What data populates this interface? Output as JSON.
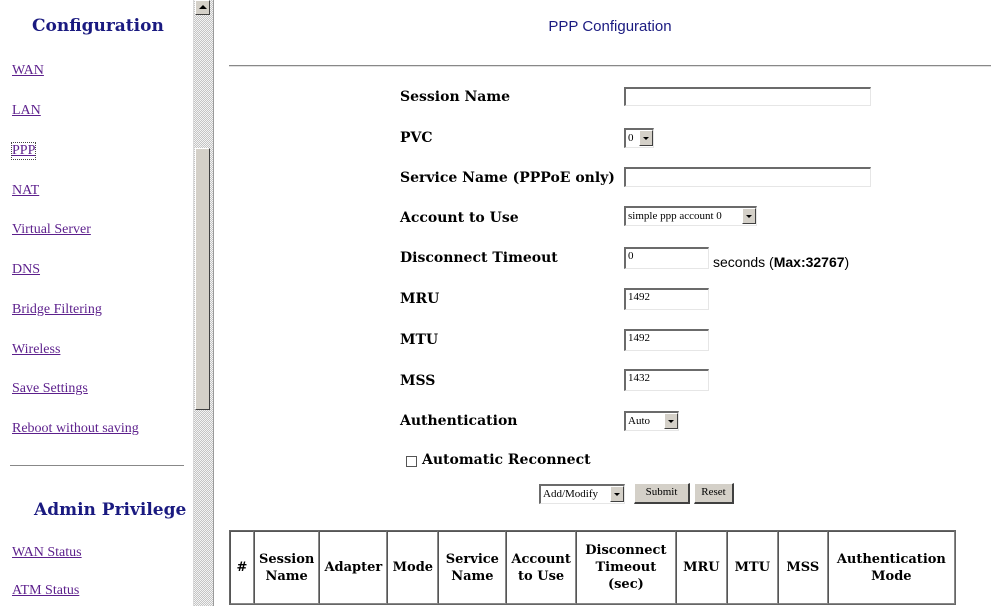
{
  "sidebar": {
    "config_title": "Configuration",
    "config_links": [
      "WAN",
      "LAN",
      "PPP",
      "NAT",
      "Virtual Server",
      "DNS",
      "Bridge Filtering",
      "Wireless",
      "Save Settings",
      "Reboot without saving"
    ],
    "active_link": "PPP",
    "admin_title": "Admin Privilege",
    "admin_links": [
      "WAN Status",
      "ATM Status"
    ]
  },
  "page": {
    "title": "PPP Configuration"
  },
  "form": {
    "session_name": {
      "label": "Session Name",
      "value": ""
    },
    "pvc": {
      "label": "PVC",
      "value": "0"
    },
    "service_name": {
      "label": "Service Name (PPPoE only)",
      "value": ""
    },
    "account": {
      "label": "Account to Use",
      "value": "simple ppp account 0"
    },
    "disconnect_timeout": {
      "label": "Disconnect Timeout",
      "value": "0",
      "suffix_prefix": "seconds (",
      "suffix_bold": "Max:",
      "suffix_value": "32767",
      "suffix_end": ")"
    },
    "mru": {
      "label": "MRU",
      "value": "1492"
    },
    "mtu": {
      "label": "MTU",
      "value": "1492"
    },
    "mss": {
      "label": "MSS",
      "value": "1432"
    },
    "authentication": {
      "label": "Authentication",
      "value": "Auto"
    },
    "auto_reconnect": {
      "label": "Automatic Reconnect",
      "checked": false
    },
    "action": {
      "value": "Add/Modify"
    },
    "submit_label": "Submit",
    "reset_label": "Reset"
  },
  "table": {
    "headers": [
      [
        "#"
      ],
      [
        "Session",
        "Name"
      ],
      [
        "Adapter"
      ],
      [
        "Mode"
      ],
      [
        "Service",
        "Name"
      ],
      [
        "Account",
        "to Use"
      ],
      [
        "Disconnect",
        "Timeout",
        "(sec)"
      ],
      [
        "MRU"
      ],
      [
        "MTU"
      ],
      [
        "MSS"
      ],
      [
        "Authentication",
        "Mode"
      ]
    ]
  }
}
